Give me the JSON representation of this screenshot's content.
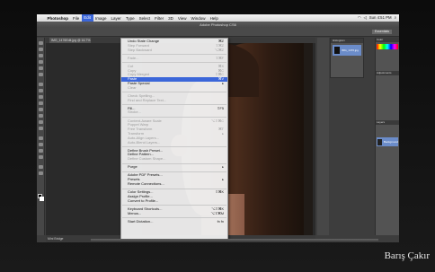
{
  "mac_menubar": {
    "app": "Photoshop",
    "items": [
      "File",
      "Edit",
      "Image",
      "Layer",
      "Type",
      "Select",
      "Filter",
      "3D",
      "View",
      "Window",
      "Help"
    ],
    "active": "Edit",
    "clock": "Sun 4:51 PM"
  },
  "app_title": "Adobe Photoshop CS6",
  "options_bar": {
    "workspace": "Essentials"
  },
  "document_tab": {
    "label": "IMG_1476Edit.jpg @ 16.7%"
  },
  "status_bar": {
    "zoom": "16.67%",
    "doc": "Mini Bridge"
  },
  "navigator_panel": {
    "title": "Histogram",
    "item_label": "IMG_1476.jpg"
  },
  "right_panels": {
    "color_title": "Color",
    "adjustments_title": "Adjustments",
    "layers_title": "Layers",
    "layer_name": "Background"
  },
  "edit_menu": {
    "items": [
      {
        "label": "Undo State Change",
        "shortcut": "⌘Z",
        "disabled": false
      },
      {
        "label": "Step Forward",
        "shortcut": "⇧⌘Z",
        "disabled": true
      },
      {
        "label": "Step Backward",
        "shortcut": "⌥⌘Z",
        "disabled": true
      },
      {
        "sep": true
      },
      {
        "label": "Fade...",
        "shortcut": "⇧⌘F",
        "disabled": true
      },
      {
        "sep": true
      },
      {
        "label": "Cut",
        "shortcut": "⌘X",
        "disabled": true
      },
      {
        "label": "Copy",
        "shortcut": "⌘C",
        "disabled": true
      },
      {
        "label": "Copy Merged",
        "shortcut": "⇧⌘C",
        "disabled": true
      },
      {
        "label": "Paste",
        "shortcut": "⌘V",
        "disabled": false,
        "highlighted": true
      },
      {
        "label": "Paste Special",
        "arrow": true,
        "disabled": false
      },
      {
        "label": "Clear",
        "disabled": true
      },
      {
        "sep": true
      },
      {
        "label": "Check Spelling...",
        "disabled": true
      },
      {
        "label": "Find and Replace Text...",
        "disabled": true
      },
      {
        "sep": true
      },
      {
        "label": "Fill...",
        "shortcut": "⇧F5",
        "disabled": false
      },
      {
        "label": "Stroke...",
        "disabled": true
      },
      {
        "sep": true
      },
      {
        "label": "Content-Aware Scale",
        "shortcut": "⌥⇧⌘C",
        "disabled": true
      },
      {
        "label": "Puppet Warp",
        "disabled": true
      },
      {
        "label": "Free Transform",
        "shortcut": "⌘T",
        "disabled": true
      },
      {
        "label": "Transform",
        "arrow": true,
        "disabled": true
      },
      {
        "label": "Auto-Align Layers...",
        "disabled": true
      },
      {
        "label": "Auto-Blend Layers...",
        "disabled": true
      },
      {
        "sep": true
      },
      {
        "label": "Define Brush Preset...",
        "disabled": false
      },
      {
        "label": "Define Pattern...",
        "disabled": false
      },
      {
        "label": "Define Custom Shape...",
        "disabled": true
      },
      {
        "sep": true
      },
      {
        "label": "Purge",
        "arrow": true,
        "disabled": false
      },
      {
        "sep": true
      },
      {
        "label": "Adobe PDF Presets...",
        "disabled": false
      },
      {
        "label": "Presets",
        "arrow": true,
        "disabled": false
      },
      {
        "label": "Remote Connections...",
        "disabled": false
      },
      {
        "sep": true
      },
      {
        "label": "Color Settings...",
        "shortcut": "⇧⌘K",
        "disabled": false
      },
      {
        "label": "Assign Profile...",
        "disabled": false
      },
      {
        "label": "Convert to Profile...",
        "disabled": false
      },
      {
        "sep": true
      },
      {
        "label": "Keyboard Shortcuts...",
        "shortcut": "⌥⇧⌘K",
        "disabled": false
      },
      {
        "label": "Menus...",
        "shortcut": "⌥⇧⌘M",
        "disabled": false
      },
      {
        "sep": true
      },
      {
        "label": "Start Dictation...",
        "shortcut": "fn fn",
        "disabled": false
      }
    ]
  },
  "caption": "Barış Çakır"
}
